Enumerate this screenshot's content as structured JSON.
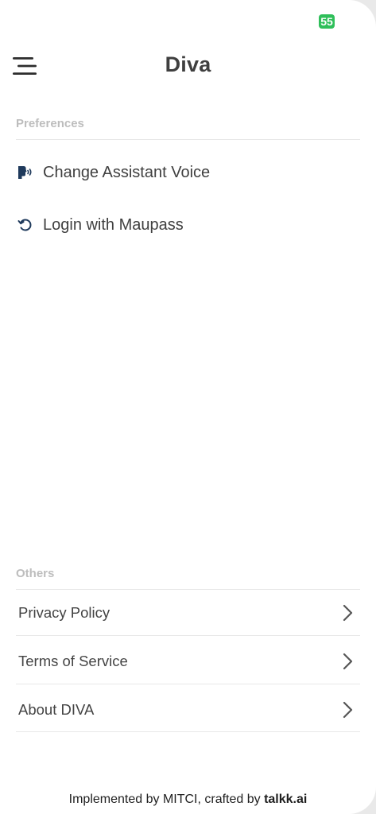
{
  "status_bar": {
    "battery_level": "55",
    "battery_color": "#2fbf5a"
  },
  "header": {
    "title": "Diva",
    "menu_icon": "hamburger-menu-icon"
  },
  "preferences": {
    "section_label": "Preferences",
    "items": [
      {
        "label": "Change Assistant Voice",
        "icon": "speaking-head-icon",
        "icon_color": "#1f3a5c"
      },
      {
        "label": "Login with Maupass",
        "icon": "refresh-arrow-icon",
        "icon_color": "#1f3a5c"
      }
    ]
  },
  "others": {
    "section_label": "Others",
    "items": [
      {
        "label": "Privacy Policy",
        "icon": "chevron-right-icon"
      },
      {
        "label": "Terms of Service",
        "icon": "chevron-right-icon"
      },
      {
        "label": "About DIVA",
        "icon": "chevron-right-icon"
      }
    ]
  },
  "footer": {
    "prefix": "Implemented by MITCI, crafted by ",
    "brand": "talkk.ai"
  }
}
